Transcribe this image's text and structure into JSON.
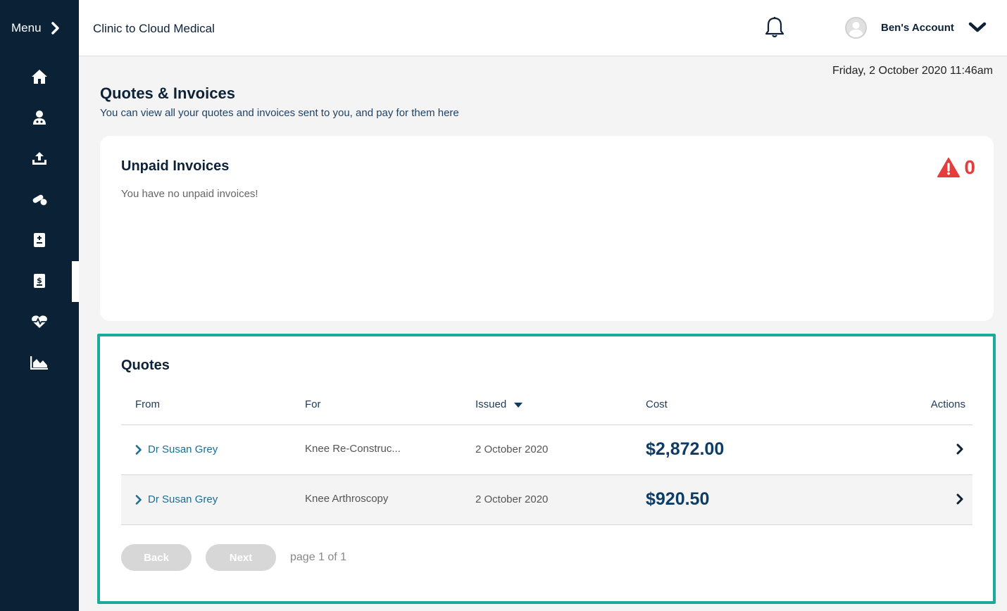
{
  "sidebar": {
    "menu_label": "Menu",
    "items": [
      {
        "icon": "home-icon"
      },
      {
        "icon": "doctor-icon"
      },
      {
        "icon": "upload-icon"
      },
      {
        "icon": "pills-icon"
      },
      {
        "icon": "medical-file-icon"
      },
      {
        "icon": "invoice-dollar-icon",
        "active": true
      },
      {
        "icon": "heartbeat-icon"
      },
      {
        "icon": "chart-area-icon"
      }
    ]
  },
  "header": {
    "clinic_name": "Clinic to Cloud Medical",
    "account_name": "Ben's Account"
  },
  "date_display": "Friday, 2 October 2020 11:46am",
  "page": {
    "title": "Quotes & Invoices",
    "subtitle": "You can view all your quotes and invoices sent to you, and pay for them here"
  },
  "unpaid": {
    "title": "Unpaid Invoices",
    "message": "You have no unpaid invoices!",
    "count": "0"
  },
  "quotes": {
    "title": "Quotes",
    "columns": {
      "from": "From",
      "for": "For",
      "issued": "Issued",
      "cost": "Cost",
      "actions": "Actions"
    },
    "rows": [
      {
        "from": "Dr Susan Grey",
        "for": "Knee Re-Construc...",
        "issued": "2 October 2020",
        "cost": "$2,872.00"
      },
      {
        "from": "Dr Susan Grey",
        "for": "Knee Arthroscopy",
        "issued": "2 October 2020",
        "cost": "$920.50"
      }
    ],
    "back_label": "Back",
    "next_label": "Next",
    "page_info": "page 1 of 1"
  },
  "colors": {
    "sidebar": "#0b2136",
    "accent_teal": "#1aab9b",
    "alert_red": "#e53c3c",
    "cost_blue": "#0d3c66",
    "link_blue": "#1c6d94"
  }
}
